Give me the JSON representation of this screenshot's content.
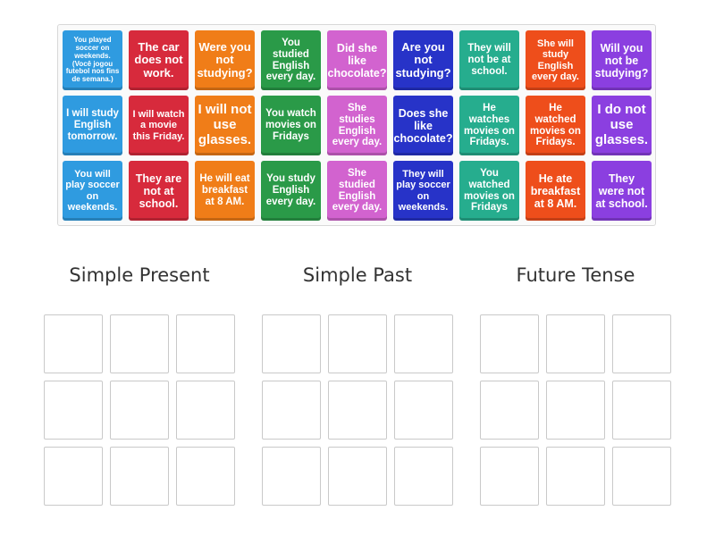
{
  "cards": [
    {
      "text": "You played soccer on weekends. (Você jogou futebol nos fins de semana.)",
      "color": "#2f9be0"
    },
    {
      "text": "The car does not work.",
      "color": "#d72a3c"
    },
    {
      "text": "Were you not studying?",
      "color": "#f07d18"
    },
    {
      "text": "You studied English every day.",
      "color": "#2a9a48"
    },
    {
      "text": "Did she like chocolate?",
      "color": "#d263cf"
    },
    {
      "text": "Are you not studying?",
      "color": "#2733c8"
    },
    {
      "text": "They will not be at school.",
      "color": "#26ad8e"
    },
    {
      "text": "She will study English every day.",
      "color": "#ee4e1b"
    },
    {
      "text": "Will you not be studying?",
      "color": "#8b3fe0"
    },
    {
      "text": "I will study English tomorrow.",
      "color": "#2f9be0"
    },
    {
      "text": "I will watch a movie this Friday.",
      "color": "#d72a3c"
    },
    {
      "text": "I will not use glasses.",
      "color": "#f07d18"
    },
    {
      "text": "You watch movies on Fridays",
      "color": "#2a9a48"
    },
    {
      "text": "She studies English every day.",
      "color": "#d263cf"
    },
    {
      "text": "Does she like chocolate?",
      "color": "#2733c8"
    },
    {
      "text": "He watches movies on Fridays.",
      "color": "#26ad8e"
    },
    {
      "text": "He watched movies on Fridays.",
      "color": "#ee4e1b"
    },
    {
      "text": "I do not use glasses.",
      "color": "#8b3fe0"
    },
    {
      "text": "You will play soccer on weekends.",
      "color": "#2f9be0"
    },
    {
      "text": "They are not at school.",
      "color": "#d72a3c"
    },
    {
      "text": "He will eat breakfast at 8 AM.",
      "color": "#f07d18"
    },
    {
      "text": "You study English every day.",
      "color": "#2a9a48"
    },
    {
      "text": "She studied English every day.",
      "color": "#d263cf"
    },
    {
      "text": "They will play soccer on weekends.",
      "color": "#2733c8"
    },
    {
      "text": "You watched movies on Fridays",
      "color": "#26ad8e"
    },
    {
      "text": "He ate breakfast at 8 AM.",
      "color": "#ee4e1b"
    },
    {
      "text": "They were not at school.",
      "color": "#8b3fe0"
    }
  ],
  "groups": [
    {
      "title": "Simple Present"
    },
    {
      "title": "Simple Past"
    },
    {
      "title": "Future Tense"
    }
  ]
}
